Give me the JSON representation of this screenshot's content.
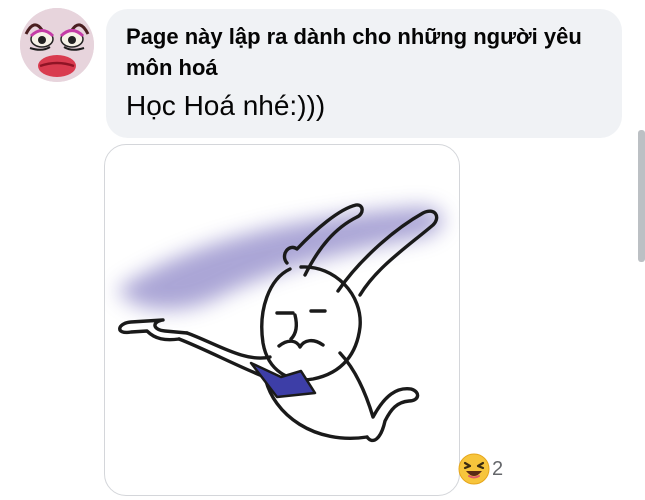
{
  "comment": {
    "author": "Page này lập ra dành cho những người yêu môn hoá",
    "text": "Học Hoá nhé:)))",
    "avatar_icon": "makeup-face-avatar-icon",
    "sticker_icon": "rabbit-pointing-sticker-icon"
  },
  "reactions": {
    "icon": "haha-laughing-emoji-icon",
    "count": "2"
  },
  "colors": {
    "bubble": "#f0f2f5",
    "text": "#050505",
    "reaction_count": "#65676b",
    "sticker_smoke": "#8a83c6",
    "bowtie": "#3d3ea7"
  }
}
